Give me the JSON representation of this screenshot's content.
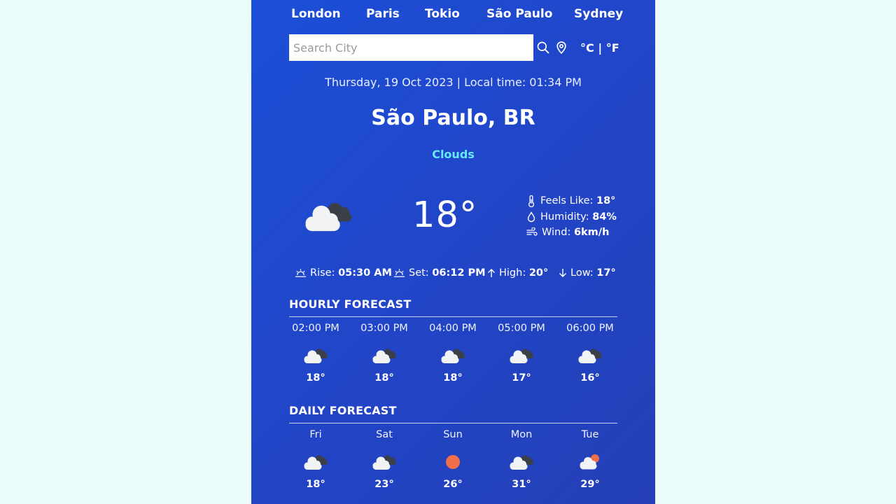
{
  "nav": {
    "cities": [
      "London",
      "Paris",
      "Tokio",
      "São Paulo",
      "Sydney"
    ]
  },
  "search": {
    "placeholder": "Search City",
    "search_icon": "search-icon",
    "location_icon": "location-pin-icon"
  },
  "units": {
    "celsius": "°C",
    "separator": "|",
    "fahrenheit": "°F"
  },
  "current": {
    "datetime": "Thursday, 19 Oct 2023 | Local time: 01:34 PM",
    "city": "São Paulo, BR",
    "condition": "Clouds",
    "icon": "broken-clouds-icon",
    "temperature": "18°",
    "details": [
      {
        "icon": "thermometer-icon",
        "label": "Feels Like:",
        "value": "18°"
      },
      {
        "icon": "droplet-icon",
        "label": "Humidity:",
        "value": "84%"
      },
      {
        "icon": "wind-icon",
        "label": "Wind:",
        "value": "6km/h"
      }
    ],
    "sun": [
      {
        "icon": "sunrise-icon",
        "label": "Rise:",
        "value": "05:30 AM"
      },
      {
        "icon": "sunset-icon",
        "label": "Set:",
        "value": "06:12 PM"
      },
      {
        "icon": "arrow-up-icon",
        "label": "High:",
        "value": "20°"
      },
      {
        "icon": "arrow-down-icon",
        "label": "Low:",
        "value": "17°"
      }
    ]
  },
  "hourly": {
    "title": "HOURLY FORECAST",
    "items": [
      {
        "title": "02:00 PM",
        "icon": "broken-clouds-icon",
        "temp": "18°"
      },
      {
        "title": "03:00 PM",
        "icon": "broken-clouds-icon",
        "temp": "18°"
      },
      {
        "title": "04:00 PM",
        "icon": "broken-clouds-icon",
        "temp": "18°"
      },
      {
        "title": "05:00 PM",
        "icon": "broken-clouds-icon",
        "temp": "17°"
      },
      {
        "title": "06:00 PM",
        "icon": "broken-clouds-icon",
        "temp": "16°"
      }
    ]
  },
  "daily": {
    "title": "DAILY FORECAST",
    "items": [
      {
        "title": "Fri",
        "icon": "broken-clouds-icon",
        "temp": "18°"
      },
      {
        "title": "Sat",
        "icon": "broken-clouds-icon",
        "temp": "23°"
      },
      {
        "title": "Sun",
        "icon": "sun-icon",
        "temp": "26°"
      },
      {
        "title": "Mon",
        "icon": "broken-clouds-icon",
        "temp": "31°"
      },
      {
        "title": "Tue",
        "icon": "few-clouds-icon",
        "temp": "29°"
      }
    ]
  },
  "colors": {
    "accent_condition": "#67e8f9",
    "sun": "#f0704a",
    "background": "#1e4ad2"
  }
}
